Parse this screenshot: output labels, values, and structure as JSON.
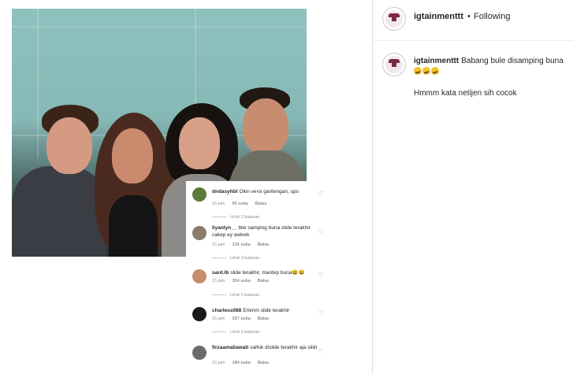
{
  "post": {
    "username": "igtainmenttt",
    "follow_separator": "•",
    "follow_status": "Following",
    "caption_text": "Babang bule disamping buna",
    "caption_emoji": [
      "thinking-face",
      "thinking-face",
      "thinking-face"
    ],
    "comment_text": "Hmmm kata netijen sih cocok"
  },
  "screenshot_comments": [
    {
      "user": "dndasyhbl",
      "text": "Okin versi gantengan, ups",
      "time": "15 jam",
      "likes": "90 suka",
      "reply": "Balas",
      "replies": "Lihat 2 balasan",
      "avatar_color": "#5d7a3a"
    },
    {
      "user": "liyanlyn__",
      "text": "btw samping buna slide terakhir cakep ey awkwk",
      "time": "15 jam",
      "likes": "124 suka",
      "reply": "Balas",
      "replies": "Lihat 3 balasan",
      "avatar_color": "#8a7b6d"
    },
    {
      "user": "sard.lb",
      "text": "slide terakhir, mantep buna😆😆",
      "time": "15 jam",
      "likes": "354 suka",
      "reply": "Balas",
      "replies": "Lihat 1 balasan",
      "avatar_color": "#c58d6b"
    },
    {
      "user": "charless088",
      "text": "Emmm slide terakhir",
      "time": "15 jam",
      "likes": "257 suka",
      "reply": "Balas",
      "replies": "Lihat 3 balasan",
      "avatar_color": "#1a1a1a"
    },
    {
      "user": "firzaamaliawati",
      "text": "salfok dislide terakhir aja siiiiii",
      "time": "15 jam",
      "likes": "184 suka",
      "reply": "Balas",
      "replies": "",
      "avatar_color": "#6b6b6b"
    }
  ],
  "colors": {
    "border": "#dbdbdb",
    "text": "#262626",
    "muted": "#8e8e8e",
    "avatar_brand": "#7a2748"
  }
}
